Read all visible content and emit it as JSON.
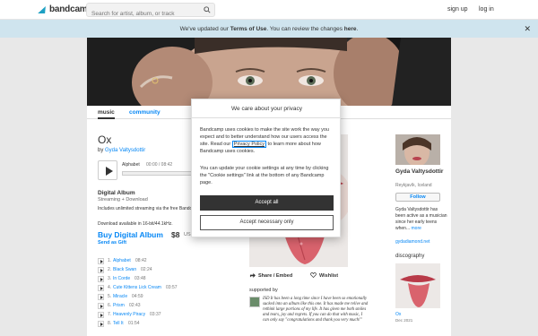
{
  "topbar": {
    "logo_text": "bandcamp",
    "search_placeholder": "Search for artist, album, or track",
    "signup": "sign up",
    "login": "log in"
  },
  "banner": {
    "prefix": "We've updated our ",
    "terms": "Terms of Use",
    "middle": ". You can review the changes ",
    "here": "here",
    "suffix": "."
  },
  "tabs": {
    "music": "music",
    "community": "community"
  },
  "album": {
    "title": "Ox",
    "by": "by",
    "artist": "Gyda Valtysdottir",
    "now_playing_title": "Alphabet",
    "now_playing_time": "00:00 / 08:42",
    "digital_head": "Digital Album",
    "digital_sub": "Streaming + Download",
    "digital_desc": "Includes unlimited streaming via the free Bandcamp app, plus high-quality download in MP3, FLAC and more.",
    "digital_desc2": "Download available in 16-bit/44.1kHz.",
    "buy": "Buy Digital Album",
    "price": "$8",
    "currency": "USD",
    "send_gift": "Send as Gift"
  },
  "tracks": [
    {
      "num": "1.",
      "title": "Alphabet",
      "time": "08:42"
    },
    {
      "num": "2.",
      "title": "Black Swan",
      "time": "02:24"
    },
    {
      "num": "3.",
      "title": "In Corde",
      "time": "03:48"
    },
    {
      "num": "4.",
      "title": "Cute Kittens Lick Cream",
      "time": "03:57"
    },
    {
      "num": "5.",
      "title": "Miracle",
      "time": "04:59"
    },
    {
      "num": "6.",
      "title": "Prism",
      "time": "02:43"
    },
    {
      "num": "7.",
      "title": "Heavenly Piracy",
      "time": "03:37"
    },
    {
      "num": "8.",
      "title": "Tell It",
      "time": "01:54"
    }
  ],
  "actions": {
    "share": "Share / Embed",
    "wishlist": "Wishlist"
  },
  "support": {
    "label": "supported by",
    "text": "ISD  It has been a long time since I have been so emotionally sucked into an album like this one. It has made me relive and rethink large portions of my life. It has given me both smiles and tears, joy and regrets. If you can do that with music, I can only say \"congratulations and thank you very much!\""
  },
  "artist": {
    "name": "Gyda Valtysdottir",
    "location": "Reykjavík, Iceland",
    "follow": "Follow",
    "bio": "Gyda Valtysdottir has been active as a musician since her early teens when...",
    "bio_more": "more",
    "site": "gydadiamond.net",
    "discography": "discography",
    "disc_title": "Ox",
    "disc_date": "Dec 2021"
  },
  "modal": {
    "title": "We care about your privacy",
    "p1_a": "Bandcamp uses cookies to make the site work the way you expect and to better understand how our users access the site. Read our ",
    "p1_link": "Privacy Policy",
    "p1_b": " to learn more about how Bandcamp uses cookies.",
    "p2": "You can update your cookie settings at any time by clicking the \"Cookie settings\" link at the bottom of any Bandcamp page.",
    "accept_all": "Accept all",
    "accept_necessary": "Accept necessary only"
  },
  "colors": {
    "accent": "#0687f5",
    "banner": "#cfe4ee",
    "logo": "#1da0c3"
  }
}
